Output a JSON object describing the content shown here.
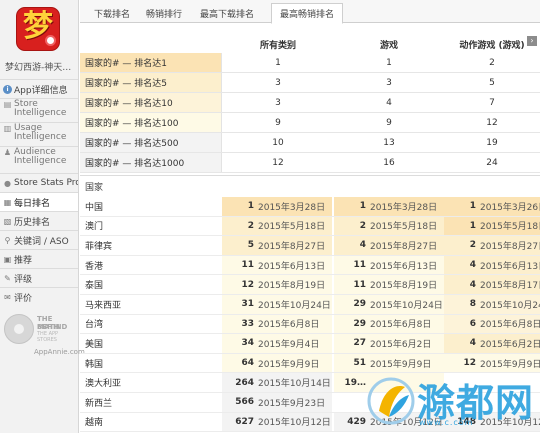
{
  "app": {
    "name": "梦幻西游-神天…",
    "icon_glyph": "梦",
    "colors": {
      "icon_bg": "#d8201e",
      "icon_glyph": "#ffd23a"
    }
  },
  "sidebar": {
    "items": [
      {
        "label": "App详细信息",
        "icon": "info-icon"
      },
      {
        "label": "Store",
        "label2": "Intelligence",
        "icon": "store-icon"
      },
      {
        "label": "Usage",
        "label2": "Intelligence",
        "icon": "usage-icon"
      },
      {
        "label": "Audience",
        "label2": "Intelligence",
        "icon": "audience-icon"
      },
      {
        "label": "Store Stats Pro",
        "icon": "stats-icon"
      },
      {
        "label": "每日排名",
        "icon": "daily-rank-icon"
      },
      {
        "label": "历史排名",
        "icon": "history-icon"
      },
      {
        "label": "关键词 / ASO",
        "icon": "keyword-icon"
      },
      {
        "label": "推荐",
        "icon": "featured-icon"
      },
      {
        "label": "评级",
        "icon": "rating-icon"
      },
      {
        "label": "评价",
        "icon": "review-icon"
      }
    ],
    "brand": {
      "line1": "THE MATH",
      "line2": "BEHIND",
      "line3": "THE APP STORES",
      "line4": "AppAnnie.com"
    }
  },
  "tabs": [
    {
      "label": "下载排名"
    },
    {
      "label": "畅销排行"
    },
    {
      "label": "最高下载排名"
    },
    {
      "label": "最高畅销排名"
    }
  ],
  "summary": {
    "columns": [
      "所有类别",
      "游戏",
      "动作游戏 (游戏)"
    ],
    "scroll_icon": "›",
    "rows": [
      {
        "label": "国家的# — 排名达1",
        "values": [
          "1",
          "1",
          "2"
        ],
        "color": "#fbe3b4"
      },
      {
        "label": "国家的# — 排名达5",
        "values": [
          "3",
          "3",
          "5"
        ],
        "color": "#fcefcd"
      },
      {
        "label": "国家的# — 排名达10",
        "values": [
          "3",
          "4",
          "7"
        ],
        "color": "#fdf3d9"
      },
      {
        "label": "国家的# — 排名达100",
        "values": [
          "9",
          "9",
          "12"
        ],
        "color": "#fefae6"
      },
      {
        "label": "国家的# — 排名达500",
        "values": [
          "10",
          "13",
          "19"
        ],
        "color": "#f3f3f3"
      },
      {
        "label": "国家的# — 排名达1000",
        "values": [
          "12",
          "16",
          "24"
        ],
        "color": "#f3f3f3"
      }
    ]
  },
  "countries": {
    "header": "国家",
    "rows": [
      {
        "name": "中国",
        "cells": [
          [
            "1",
            "2015年3月28日"
          ],
          [
            "1",
            "2015年3月28日"
          ],
          [
            "1",
            "2015年3月26日"
          ]
        ]
      },
      {
        "name": "澳门",
        "cells": [
          [
            "2",
            "2015年5月18日"
          ],
          [
            "2",
            "2015年5月18日"
          ],
          [
            "1",
            "2015年5月18日"
          ]
        ]
      },
      {
        "name": "菲律宾",
        "cells": [
          [
            "5",
            "2015年8月27日"
          ],
          [
            "4",
            "2015年8月27日"
          ],
          [
            "2",
            "2015年8月27日"
          ]
        ]
      },
      {
        "name": "香港",
        "cells": [
          [
            "11",
            "2015年6月13日"
          ],
          [
            "11",
            "2015年6月13日"
          ],
          [
            "4",
            "2015年6月13日"
          ]
        ]
      },
      {
        "name": "泰国",
        "cells": [
          [
            "12",
            "2015年8月19日"
          ],
          [
            "11",
            "2015年8月19日"
          ],
          [
            "4",
            "2015年8月17日"
          ]
        ]
      },
      {
        "name": "马来西亚",
        "cells": [
          [
            "31",
            "2015年10月24日"
          ],
          [
            "29",
            "2015年10月24日"
          ],
          [
            "8",
            "2015年10月24日"
          ]
        ]
      },
      {
        "name": "台湾",
        "cells": [
          [
            "33",
            "2015年6月8日"
          ],
          [
            "29",
            "2015年6月8日"
          ],
          [
            "6",
            "2015年6月8日"
          ]
        ]
      },
      {
        "name": "美国",
        "cells": [
          [
            "34",
            "2015年9月4日"
          ],
          [
            "27",
            "2015年6月2日"
          ],
          [
            "4",
            "2015年6月2日"
          ]
        ]
      },
      {
        "name": "韩国",
        "cells": [
          [
            "64",
            "2015年9月9日"
          ],
          [
            "51",
            "2015年9月9日"
          ],
          [
            "12",
            "2015年9月9日"
          ]
        ]
      },
      {
        "name": "澳大利亚",
        "cells": [
          [
            "264",
            "2015年10月14日"
          ],
          [
            "19…",
            ""
          ],
          [
            "",
            ""
          ]
        ]
      },
      {
        "name": "新西兰",
        "cells": [
          [
            "566",
            "2015年9月23日"
          ],
          [
            "",
            ""
          ],
          [
            "",
            ""
          ]
        ]
      },
      {
        "name": "越南",
        "cells": [
          [
            "627",
            "2015年10月12日"
          ],
          [
            "429",
            "2015年10月12日"
          ],
          [
            "148",
            "2015年10月12日"
          ]
        ]
      }
    ]
  },
  "watermark": {
    "text": "滁都网",
    "url": "www.c.com"
  }
}
